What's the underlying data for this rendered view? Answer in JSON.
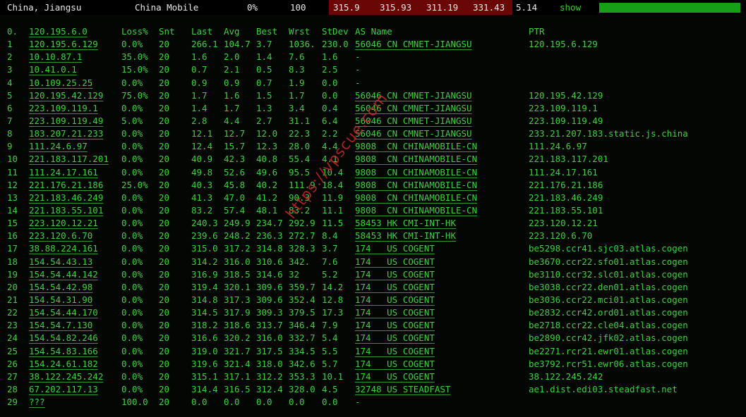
{
  "header": {
    "location": "China, Jiangsu",
    "isp": "China Mobile",
    "loss": "0%",
    "sent": "100",
    "lat_last": "315.9",
    "lat_avg": "315.93",
    "lat_best": "311.19",
    "lat_worst": "331.43",
    "stdev": "5.14",
    "show_link": "show",
    "bar_color": "#17a017"
  },
  "columns": {
    "no": "0.",
    "host": "120.195.6.0",
    "loss": "Loss%",
    "snt": "Snt",
    "last": "Last",
    "avg": "Avg",
    "best": "Best",
    "wrst": "Wrst",
    "stdev": "StDev",
    "as": "AS Name",
    "ptr": "PTR"
  },
  "rows": [
    {
      "no": "1",
      "host": "120.195.6.129",
      "loss": "0.0%",
      "snt": "20",
      "last": "266.1",
      "avg": "104.7",
      "best": "3.7",
      "wrst": "1036.",
      "stdev": "230.0",
      "as": "56046 CN CMNET-JIANGSU",
      "ptr": "120.195.6.129"
    },
    {
      "no": "2",
      "host": "10.10.87.1",
      "loss": "35.0%",
      "snt": "20",
      "last": "1.6",
      "avg": "2.0",
      "best": "1.4",
      "wrst": "7.6",
      "stdev": "1.6",
      "as": "-",
      "ptr": ""
    },
    {
      "no": "3",
      "host": "10.41.0.1",
      "loss": "15.0%",
      "snt": "20",
      "last": "0.7",
      "avg": "2.1",
      "best": "0.5",
      "wrst": "8.3",
      "stdev": "2.5",
      "as": "-",
      "ptr": ""
    },
    {
      "no": "4",
      "host": "10.109.25.25",
      "loss": "0.0%",
      "snt": "20",
      "last": "0.9",
      "avg": "0.9",
      "best": "0.7",
      "wrst": "1.9",
      "stdev": "0.0",
      "as": "-",
      "ptr": ""
    },
    {
      "no": "5",
      "host": "120.195.42.129",
      "loss": "75.0%",
      "snt": "20",
      "last": "1.7",
      "avg": "1.6",
      "best": "1.5",
      "wrst": "1.7",
      "stdev": "0.0",
      "as": "56046 CN CMNET-JIANGSU",
      "ptr": "120.195.42.129"
    },
    {
      "no": "6",
      "host": "223.109.119.1",
      "loss": "0.0%",
      "snt": "20",
      "last": "1.4",
      "avg": "1.7",
      "best": "1.3",
      "wrst": "3.4",
      "stdev": "0.4",
      "as": "56046 CN CMNET-JIANGSU",
      "ptr": "223.109.119.1"
    },
    {
      "no": "7",
      "host": "223.109.119.49",
      "loss": "5.0%",
      "snt": "20",
      "last": "2.8",
      "avg": "4.4",
      "best": "2.7",
      "wrst": "31.1",
      "stdev": "6.4",
      "as": "56046 CN CMNET-JIANGSU",
      "ptr": "223.109.119.49"
    },
    {
      "no": "8",
      "host": "183.207.21.233",
      "loss": "0.0%",
      "snt": "20",
      "last": "12.1",
      "avg": "12.7",
      "best": "12.0",
      "wrst": "22.3",
      "stdev": "2.2",
      "as": "56046 CN CMNET-JIANGSU",
      "ptr": "233.21.207.183.static.js.china"
    },
    {
      "no": "9",
      "host": "111.24.6.97",
      "loss": "0.0%",
      "snt": "20",
      "last": "12.4",
      "avg": "15.7",
      "best": "12.3",
      "wrst": "28.0",
      "stdev": "4.4",
      "as": "9808  CN CHINAMOBILE-CN",
      "ptr": "111.24.6.97"
    },
    {
      "no": "10",
      "host": "221.183.117.201",
      "loss": "0.0%",
      "snt": "20",
      "last": "40.9",
      "avg": "42.3",
      "best": "40.8",
      "wrst": "55.4",
      "stdev": "4.1",
      "as": "9808  CN CHINAMOBILE-CN",
      "ptr": "221.183.117.201"
    },
    {
      "no": "11",
      "host": "111.24.17.161",
      "loss": "0.0%",
      "snt": "20",
      "last": "49.8",
      "avg": "52.6",
      "best": "49.6",
      "wrst": "95.5",
      "stdev": "10.4",
      "as": "9808  CN CHINAMOBILE-CN",
      "ptr": "111.24.17.161"
    },
    {
      "no": "12",
      "host": "221.176.21.186",
      "loss": "25.0%",
      "snt": "20",
      "last": "40.3",
      "avg": "45.8",
      "best": "40.2",
      "wrst": "111.9",
      "stdev": "18.4",
      "as": "9808  CN CHINAMOBILE-CN",
      "ptr": "221.176.21.186"
    },
    {
      "no": "13",
      "host": "221.183.46.249",
      "loss": "0.0%",
      "snt": "20",
      "last": "41.3",
      "avg": "47.0",
      "best": "41.2",
      "wrst": "90.3",
      "stdev": "11.9",
      "as": "9808  CN CHINAMOBILE-CN",
      "ptr": "221.183.46.249"
    },
    {
      "no": "14",
      "host": "221.183.55.101",
      "loss": "0.0%",
      "snt": "20",
      "last": "83.2",
      "avg": "57.4",
      "best": "48.1",
      "wrst": "83.2",
      "stdev": "11.1",
      "as": "9808  CN CHINAMOBILE-CN",
      "ptr": "221.183.55.101"
    },
    {
      "no": "15",
      "host": "223.120.12.21",
      "loss": "0.0%",
      "snt": "20",
      "last": "240.3",
      "avg": "249.9",
      "best": "234.7",
      "wrst": "292.9",
      "stdev": "11.5",
      "as": "58453 HK CMI-INT-HK",
      "ptr": "223.120.12.21"
    },
    {
      "no": "16",
      "host": "223.120.6.70",
      "loss": "0.0%",
      "snt": "20",
      "last": "239.6",
      "avg": "248.2",
      "best": "236.3",
      "wrst": "272.7",
      "stdev": "8.4",
      "as": "58453 HK CMI-INT-HK",
      "ptr": "223.120.6.70"
    },
    {
      "no": "17",
      "host": "38.88.224.161",
      "loss": "0.0%",
      "snt": "20",
      "last": "315.0",
      "avg": "317.2",
      "best": "314.8",
      "wrst": "328.3",
      "stdev": "3.7",
      "as": "174   US COGENT",
      "ptr": "be5298.ccr41.sjc03.atlas.cogen"
    },
    {
      "no": "18",
      "host": "154.54.43.13",
      "loss": "0.0%",
      "snt": "20",
      "last": "314.2",
      "avg": "316.0",
      "best": "310.6",
      "wrst": "342.",
      "stdev": "7.6",
      "as": "174   US COGENT",
      "ptr": "be3670.ccr22.sfo01.atlas.cogen"
    },
    {
      "no": "19",
      "host": "154.54.44.142",
      "loss": "0.0%",
      "snt": "20",
      "last": "316.9",
      "avg": "318.5",
      "best": "314.6",
      "wrst": "32",
      "stdev": "5.2",
      "as": "174   US COGENT",
      "ptr": "be3110.ccr32.slc01.atlas.cogen"
    },
    {
      "no": "20",
      "host": "154.54.42.98",
      "loss": "0.0%",
      "snt": "20",
      "last": "319.4",
      "avg": "320.1",
      "best": "309.6",
      "wrst": "359.7",
      "stdev": "14.2",
      "as": "174   US COGENT",
      "ptr": "be3038.ccr22.den01.atlas.cogen"
    },
    {
      "no": "21",
      "host": "154.54.31.90",
      "loss": "0.0%",
      "snt": "20",
      "last": "314.8",
      "avg": "317.3",
      "best": "309.6",
      "wrst": "352.4",
      "stdev": "12.8",
      "as": "174   US COGENT",
      "ptr": "be3036.ccr22.mci01.atlas.cogen"
    },
    {
      "no": "22",
      "host": "154.54.44.170",
      "loss": "0.0%",
      "snt": "20",
      "last": "314.5",
      "avg": "317.9",
      "best": "309.3",
      "wrst": "379.5",
      "stdev": "17.3",
      "as": "174   US COGENT",
      "ptr": "be2832.ccr42.ord01.atlas.cogen"
    },
    {
      "no": "23",
      "host": "154.54.7.130",
      "loss": "0.0%",
      "snt": "20",
      "last": "318.2",
      "avg": "318.6",
      "best": "313.7",
      "wrst": "346.4",
      "stdev": "7.9",
      "as": "174   US COGENT",
      "ptr": "be2718.ccr22.cle04.atlas.cogen"
    },
    {
      "no": "24",
      "host": "154.54.82.246",
      "loss": "0.0%",
      "snt": "20",
      "last": "316.6",
      "avg": "320.2",
      "best": "316.0",
      "wrst": "332.7",
      "stdev": "5.4",
      "as": "174   US COGENT",
      "ptr": "be2890.ccr42.jfk02.atlas.cogen"
    },
    {
      "no": "25",
      "host": "154.54.83.166",
      "loss": "0.0%",
      "snt": "20",
      "last": "319.0",
      "avg": "321.7",
      "best": "317.5",
      "wrst": "334.5",
      "stdev": "5.5",
      "as": "174   US COGENT",
      "ptr": "be2271.rcr21.ewr01.atlas.cogen"
    },
    {
      "no": "26",
      "host": "154.24.61.182",
      "loss": "0.0%",
      "snt": "20",
      "last": "319.6",
      "avg": "321.4",
      "best": "318.0",
      "wrst": "342.6",
      "stdev": "5.7",
      "as": "174   US COGENT",
      "ptr": "be3792.rcr51.ewr06.atlas.cogen"
    },
    {
      "no": "27",
      "host": "38.122.245.242",
      "loss": "0.0%",
      "snt": "20",
      "last": "315.1",
      "avg": "317.1",
      "best": "312.2",
      "wrst": "353.3",
      "stdev": "10.1",
      "as": "174   US COGENT",
      "ptr": "38.122.245.242"
    },
    {
      "no": "28",
      "host": "67.202.117.13",
      "loss": "0.0%",
      "snt": "20",
      "last": "314.4",
      "avg": "316.5",
      "best": "312.4",
      "wrst": "328.0",
      "stdev": "4.5",
      "as": "32748 US STEADFAST",
      "ptr": "ae1.dist.edi03.steadfast.net"
    },
    {
      "no": "29",
      "host": "???",
      "loss": "100.0",
      "snt": "20",
      "last": "0.0",
      "avg": "0.0",
      "best": "0.0",
      "wrst": "0.0",
      "stdev": "0.0",
      "as": "-",
      "ptr": ""
    }
  ],
  "watermark": "https://vpscue.com"
}
